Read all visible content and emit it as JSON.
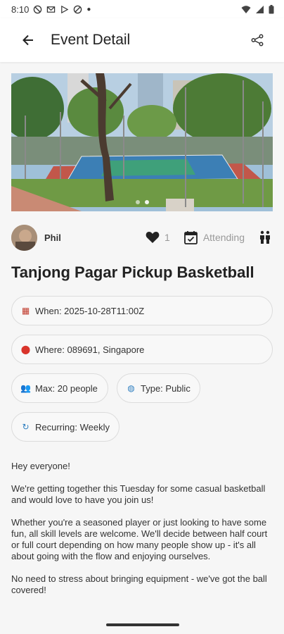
{
  "status_bar": {
    "time": "8:10"
  },
  "app_bar": {
    "title": "Event Detail"
  },
  "author": {
    "name": "Phil"
  },
  "stats": {
    "likes": "1",
    "attending_label": "Attending"
  },
  "event": {
    "title": "Tanjong Pagar Pickup Basketball",
    "when": "When: 2025-10-28T11:00Z",
    "where": "Where: 089691, Singapore",
    "max": "Max: 20 people",
    "type": "Type: Public",
    "recurring": "Recurring: Weekly"
  },
  "description": {
    "p1": "Hey everyone!",
    "p2": "We're getting together this Tuesday for some casual basketball and would love to have you join us!",
    "p3": "Whether you're a seasoned player or just looking to have some fun, all skill levels are welcome. We'll decide between half court or full court depending on how many people show up - it's all about going with the flow and enjoying ourselves.",
    "p4": "No need to stress about bringing equipment - we've got the ball covered!"
  },
  "icons": {
    "back": "arrow-left-icon",
    "share": "share-icon",
    "like": "heart-icon",
    "attend": "calendar-check-icon",
    "people": "people-icon",
    "when": "calendar-emoji-icon",
    "where": "pin-emoji-icon",
    "max": "people-emoji-icon",
    "type": "globe-emoji-icon",
    "recurring": "repeat-emoji-icon"
  }
}
